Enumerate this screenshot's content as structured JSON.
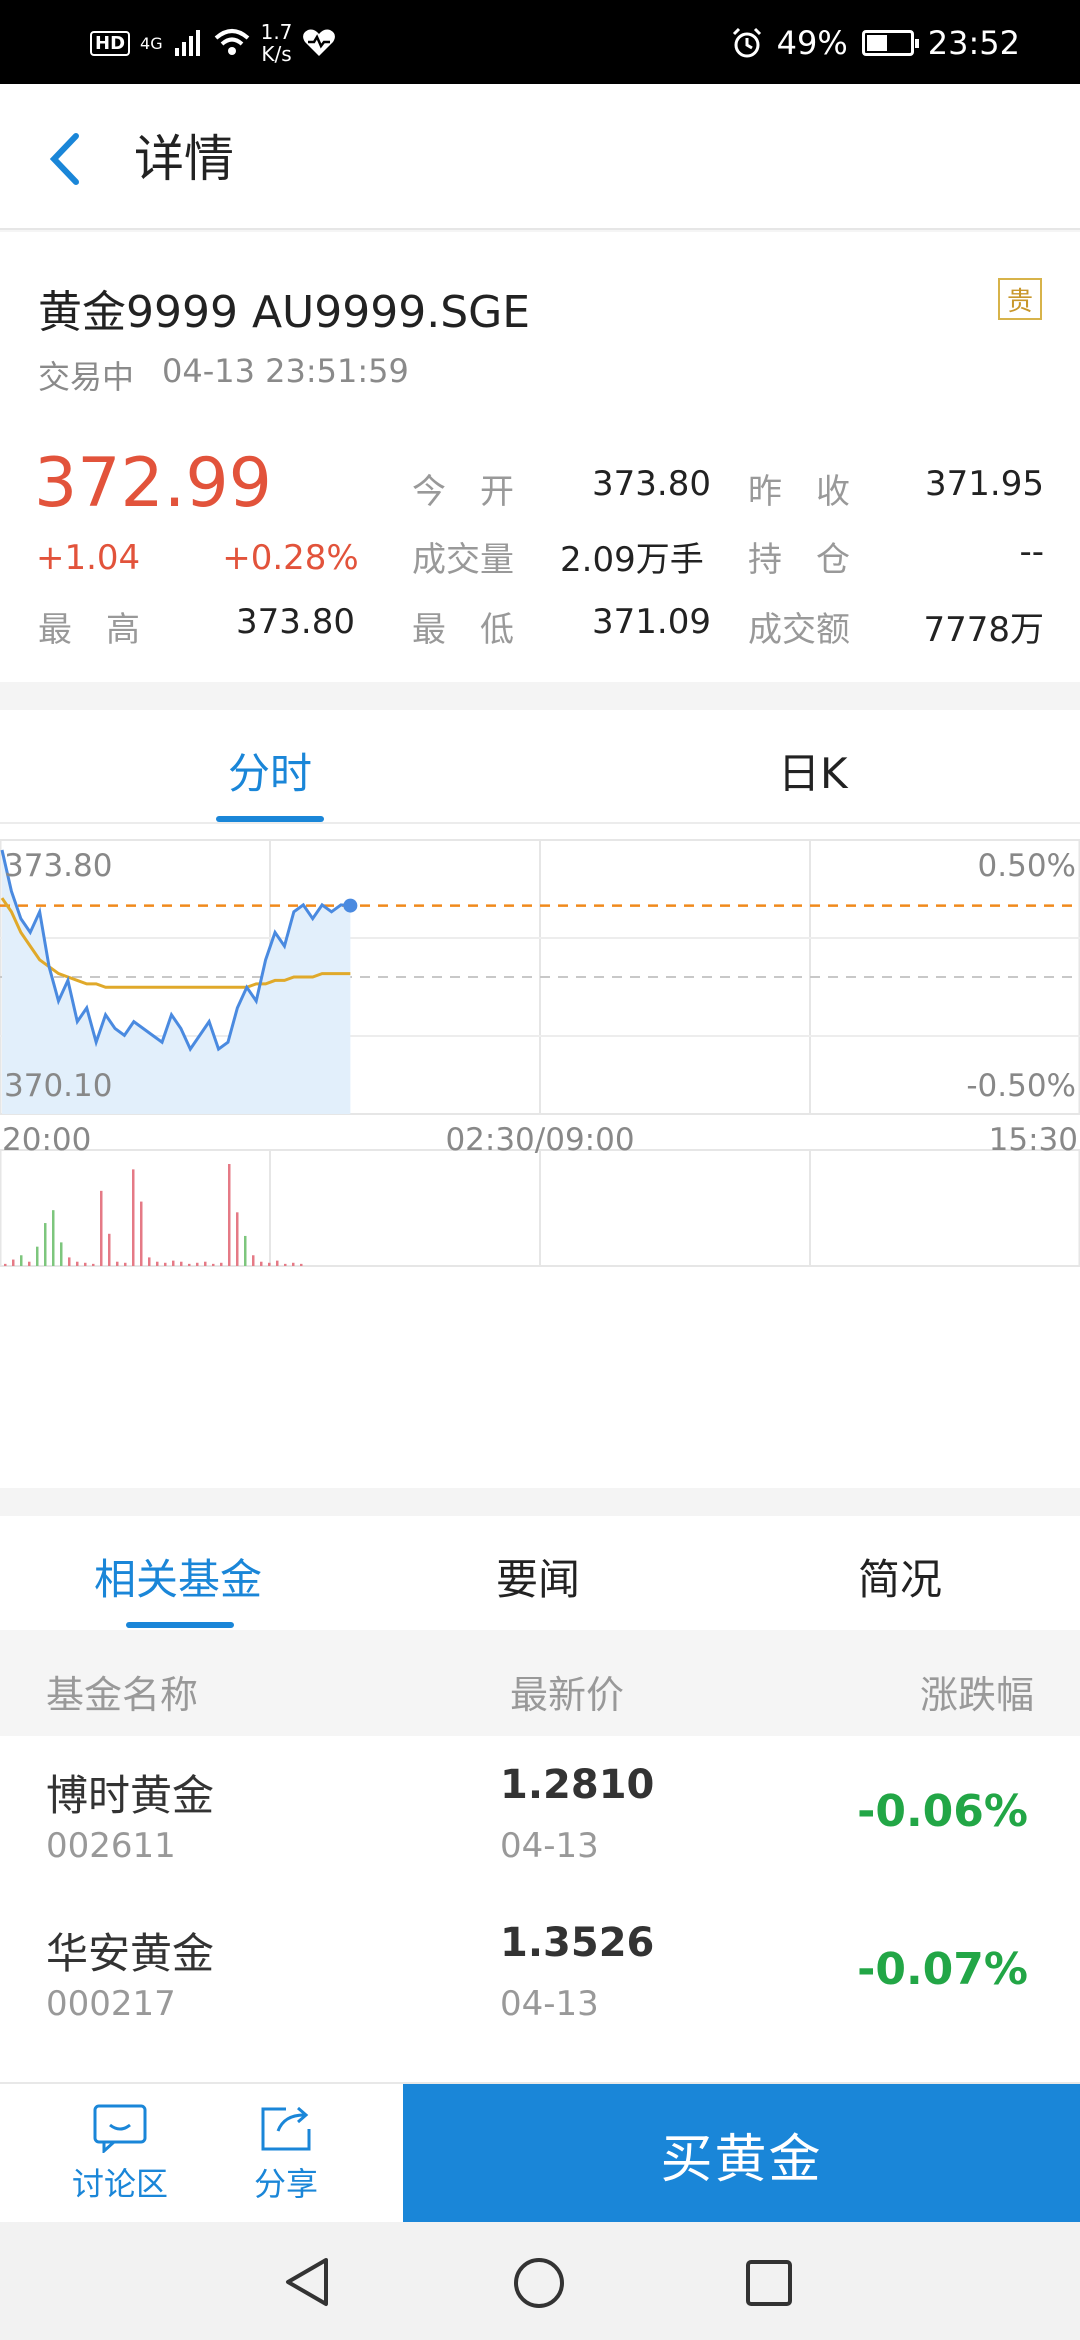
{
  "status_bar": {
    "network": "4G",
    "speed_value": "1.7",
    "speed_unit": "K/s",
    "battery": "49%",
    "time": "23:52"
  },
  "nav": {
    "title": "详情"
  },
  "quote": {
    "name": "黄金9999 AU9999.SGE",
    "badge": "贵",
    "status": "交易中",
    "timestamp": "04-13 23:51:59",
    "price": "372.99",
    "change": "+1.04",
    "change_pct": "+0.28%",
    "high_label": "最　高",
    "high": "373.80",
    "open_label": "今　开",
    "open": "373.80",
    "volume_label": "成交量",
    "volume": "2.09万手",
    "low_label": "最　低",
    "low": "371.09",
    "prev_close_label": "昨　收",
    "prev_close": "371.95",
    "position_label": "持　仓",
    "position": "--",
    "turnover_label": "成交额",
    "turnover": "7778万"
  },
  "chart_tabs": [
    "分时",
    "日K"
  ],
  "chart_data": {
    "type": "line",
    "title": "",
    "y_left_ticks": [
      "373.80",
      "370.10"
    ],
    "y_right_ticks": [
      "0.50%",
      "-0.50%"
    ],
    "x_ticks": [
      "20:00",
      "02:30/09:00",
      "15:30"
    ],
    "ylim": [
      370.1,
      373.8
    ],
    "prev_close": 371.95,
    "series": [
      {
        "name": "",
        "role": "price",
        "color": "#4a8ae0",
        "values": [
          373.8,
          373.2,
          372.8,
          372.6,
          372.9,
          372.1,
          371.6,
          371.9,
          371.3,
          371.5,
          371.0,
          371.4,
          371.2,
          371.1,
          371.3,
          371.2,
          371.1,
          371.0,
          371.4,
          371.2,
          370.9,
          371.1,
          371.3,
          370.9,
          371.0,
          371.5,
          371.8,
          371.6,
          372.2,
          372.6,
          372.4,
          372.9,
          373.0,
          372.8,
          373.0,
          372.9,
          373.0,
          372.99
        ],
        "x_index": [
          0,
          1,
          2,
          3,
          4,
          5,
          6,
          7,
          8,
          9,
          10,
          11,
          12,
          13,
          14,
          15,
          16,
          17,
          18,
          19,
          20,
          21,
          22,
          23,
          24,
          25,
          26,
          27,
          28,
          29,
          30,
          31,
          32,
          33,
          34,
          35,
          36,
          37
        ]
      },
      {
        "name": "",
        "role": "average",
        "color": "#e0a92a",
        "values": [
          373.1,
          372.9,
          372.6,
          372.4,
          372.2,
          372.1,
          372.0,
          371.95,
          371.9,
          371.85,
          371.85,
          371.8,
          371.8,
          371.8,
          371.8,
          371.8,
          371.8,
          371.8,
          371.8,
          371.8,
          371.8,
          371.8,
          371.8,
          371.8,
          371.8,
          371.8,
          371.8,
          371.85,
          371.85,
          371.9,
          371.9,
          371.95,
          371.95,
          371.95,
          372.0,
          372.0,
          372.0,
          372.0
        ],
        "x_index": [
          0,
          1,
          2,
          3,
          4,
          5,
          6,
          7,
          8,
          9,
          10,
          11,
          12,
          13,
          14,
          15,
          16,
          17,
          18,
          19,
          20,
          21,
          22,
          23,
          24,
          25,
          26,
          27,
          28,
          29,
          30,
          31,
          32,
          33,
          34,
          35,
          36,
          37
        ]
      }
    ],
    "volume": [
      {
        "v": 2,
        "c": "#e57a86"
      },
      {
        "v": 6,
        "c": "#e57a86"
      },
      {
        "v": 10,
        "c": "#7dc67d"
      },
      {
        "v": 4,
        "c": "#e57a86"
      },
      {
        "v": 18,
        "c": "#7dc67d"
      },
      {
        "v": 40,
        "c": "#7dc67d"
      },
      {
        "v": 52,
        "c": "#7dc67d"
      },
      {
        "v": 22,
        "c": "#7dc67d"
      },
      {
        "v": 8,
        "c": "#e57a86"
      },
      {
        "v": 4,
        "c": "#e57a86"
      },
      {
        "v": 3,
        "c": "#e57a86"
      },
      {
        "v": 2,
        "c": "#e57a86"
      },
      {
        "v": 70,
        "c": "#e57a86"
      },
      {
        "v": 30,
        "c": "#e57a86"
      },
      {
        "v": 4,
        "c": "#e57a86"
      },
      {
        "v": 3,
        "c": "#e57a86"
      },
      {
        "v": 90,
        "c": "#e57a86"
      },
      {
        "v": 60,
        "c": "#e57a86"
      },
      {
        "v": 8,
        "c": "#e57a86"
      },
      {
        "v": 4,
        "c": "#e57a86"
      },
      {
        "v": 3,
        "c": "#e57a86"
      },
      {
        "v": 5,
        "c": "#e57a86"
      },
      {
        "v": 4,
        "c": "#e57a86"
      },
      {
        "v": 2,
        "c": "#e57a86"
      },
      {
        "v": 3,
        "c": "#e57a86"
      },
      {
        "v": 4,
        "c": "#e57a86"
      },
      {
        "v": 2,
        "c": "#e57a86"
      },
      {
        "v": 3,
        "c": "#e57a86"
      },
      {
        "v": 95,
        "c": "#e57a86"
      },
      {
        "v": 50,
        "c": "#e57a86"
      },
      {
        "v": 28,
        "c": "#7dc67d"
      },
      {
        "v": 10,
        "c": "#e57a86"
      },
      {
        "v": 4,
        "c": "#e57a86"
      },
      {
        "v": 3,
        "c": "#e57a86"
      },
      {
        "v": 5,
        "c": "#e57a86"
      },
      {
        "v": 2,
        "c": "#e57a86"
      },
      {
        "v": 3,
        "c": "#e57a86"
      },
      {
        "v": 2,
        "c": "#e57a86"
      }
    ]
  },
  "fund_tabs": [
    "相关基金",
    "要闻",
    "简况"
  ],
  "fund_table": {
    "headers": [
      "基金名称",
      "最新价",
      "涨跌幅"
    ],
    "rows": [
      {
        "name": "博时黄金",
        "code": "002611",
        "price": "1.2810",
        "date": "04-13",
        "change": "-0.06%"
      },
      {
        "name": "华安黄金",
        "code": "000217",
        "price": "1.3526",
        "date": "04-13",
        "change": "-0.07%"
      }
    ]
  },
  "bottom_bar": {
    "discuss_label": "讨论区",
    "share_label": "分享",
    "buy_label": "买黄金"
  },
  "colors": {
    "accent": "#1a86d8",
    "up": "#e2533b",
    "down": "#22a646"
  }
}
